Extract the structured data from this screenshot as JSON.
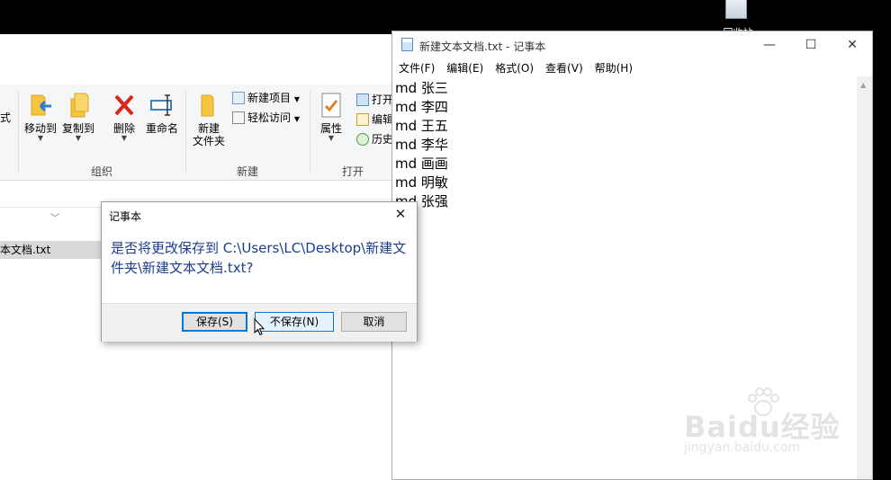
{
  "desktop": {
    "recycle_bin_label": "回收站"
  },
  "explorer": {
    "ribbon": {
      "partial_left_label": "式",
      "move_to": "移动到",
      "copy_to": "复制到",
      "delete": "删除",
      "rename": "重命名",
      "new_folder_line1": "新建",
      "new_folder_line2": "文件夹",
      "new_item": "新建项目",
      "easy_access": "轻松访问",
      "properties": "属性",
      "open": "打开",
      "edit": "编辑",
      "history": "历史",
      "group_organize": "组织",
      "group_new": "新建",
      "group_open": "打开"
    },
    "file_row": "本文档.txt"
  },
  "notepad": {
    "title": "新建文本文档.txt - 记事本",
    "menu": [
      "文件(F)",
      "编辑(E)",
      "格式(O)",
      "查看(V)",
      "帮助(H)"
    ],
    "lines": [
      "md 张三",
      "md 李四",
      "md 王五",
      "md 李华",
      "md 画画",
      "md 明敏",
      "md 张强"
    ],
    "controls": {
      "minimize": "—",
      "maximize": "☐",
      "close": "✕"
    }
  },
  "dialog": {
    "title": "记事本",
    "message": "是否将更改保存到 C:\\Users\\LC\\Desktop\\新建文件夹\\新建文本文档.txt?",
    "save_button": "保存(S)",
    "dont_save_button": "不保存(N)",
    "cancel_button": "取消",
    "close_symbol": "✕"
  },
  "watermark": {
    "logo": "Baidu经验",
    "url": "jingyan.baidu.com"
  }
}
